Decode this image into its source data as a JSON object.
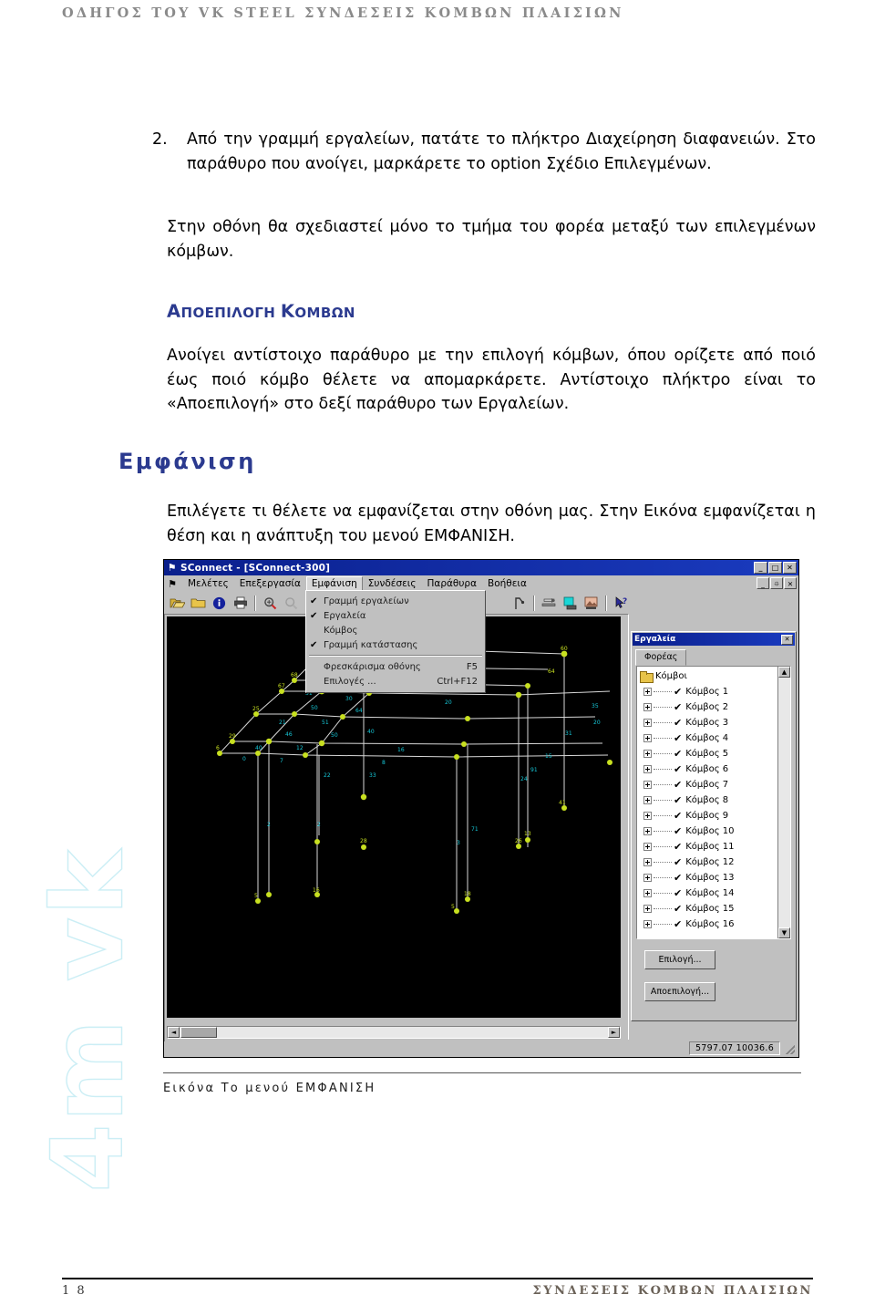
{
  "page": {
    "header": "ΟΔΗΓΟΣ ΤΟΥ VK STEEL ΣΥΝΔΕΣΕΙΣ ΚΟΜΒΩΝ ΠΛΑΙΣΙΩΝ",
    "watermark": "4m vk",
    "footer_page_number": "1 8",
    "footer_title": "ΣΥΝΔΕΣΕΙΣ ΚΟΜΒΩΝ ΠΛΑΙΣΙΩΝ"
  },
  "body": {
    "list_item_number": "2.",
    "list_item_text": "Από την γραμμή εργαλείων, πατάτε το πλήκτρο Διαχείρηση διαφανειών. Στο παράθυρο που ανοίγει, μαρκάρετε το option Σχέδιο Επιλεγμένων.",
    "paragraph_frame": "Στην οθόνη θα σχεδιαστεί μόνο το τμήμα του φορέα μεταξύ των επιλεγμένων κόμβων.",
    "heading_deselect_first": "Α",
    "heading_deselect_rest": "ΠΟΕΠΙΛΟΓΗ",
    "heading_deselect_second_first": "Κ",
    "heading_deselect_second_rest": "ΟΜΒΩΝ",
    "paragraph_deselect": "Ανοίγει αντίστοιχο παράθυρο με την επιλογή κόμβων, όπου ορίζετε από ποιό έως ποιό κόμβο θέλετε να απομαρκάρετε. Αντίστοιχο πλήκτρο είναι το «Αποεπιλογή» στο δεξί παράθυρο των Εργαλείων.",
    "heading_display": "Εμφάνιση",
    "paragraph_display": "Επιλέγετε τι θέλετε να εμφανίζεται στην οθόνη μας. Στην Εικόνα εμφανίζεται η θέση και η ανάπτυξη του μενού ΕΜΦΑΝΙΣΗ.",
    "figure_caption": "Εικόνα Το μενού ΕΜΦΑΝΙΣΗ"
  },
  "app": {
    "title": "SConnect  - [SConnect-300]",
    "title_icon": "flag-icon",
    "window_buttons": [
      "_",
      "□",
      "✕"
    ],
    "mdi_buttons": [
      "_",
      "⯐",
      "✕"
    ],
    "menu": [
      {
        "label": "Μελέτες",
        "active": false
      },
      {
        "label": "Επεξεργασία",
        "active": false
      },
      {
        "label": "Εμφάνιση",
        "active": true
      },
      {
        "label": "Συνδέσεις",
        "active": false
      },
      {
        "label": "Παράθυρα",
        "active": false
      },
      {
        "label": "Βοήθεια",
        "active": false
      }
    ],
    "toolbar_icons": [
      "open-folder-icon",
      "folder-icon",
      "info-icon",
      "print-icon",
      "zoom-in-icon",
      "zoom-out-icon",
      "pan-icon",
      "node-icon",
      "connection-icon",
      "panel-icon",
      "export-icon",
      "help-pointer-icon"
    ],
    "dropdown": {
      "items": [
        {
          "label": "Γραμμή εργαλείων",
          "checked": true,
          "accel": ""
        },
        {
          "label": "Εργαλεία",
          "checked": true,
          "accel": ""
        },
        {
          "label": "Κόμβος",
          "checked": false,
          "accel": ""
        },
        {
          "label": "Γραμμή κατάστασης",
          "checked": true,
          "accel": ""
        },
        {
          "separator": true
        },
        {
          "label": "Φρεσκάρισμα οθόνης",
          "checked": false,
          "accel": "F5"
        },
        {
          "label": "Επιλογές ...",
          "checked": false,
          "accel": "Ctrl+F12"
        }
      ]
    },
    "tools_panel": {
      "title": "Εργαλεία",
      "close_label": "✕",
      "tab": "Φορέας",
      "tree_root": "Κόμβοι",
      "tree_items": [
        "Κόμβος 1",
        "Κόμβος 2",
        "Κόμβος 3",
        "Κόμβος 4",
        "Κόμβος 5",
        "Κόμβος 6",
        "Κόμβος 7",
        "Κόμβος 8",
        "Κόμβος 9",
        "Κόμβος 10",
        "Κόμβος 11",
        "Κόμβος 12",
        "Κόμβος 13",
        "Κόμβος 14",
        "Κόμβος 15",
        "Κόμβος 16"
      ],
      "select_button": "Επιλογή...",
      "deselect_button": "Αποεπιλογή..."
    },
    "statusbar": {
      "coordinates": "5797.07  10036.6"
    },
    "scroll_arrows": {
      "left": "◄",
      "right": "►",
      "up": "▲",
      "down": "▼"
    }
  },
  "colors": {
    "heading_blue": "#2b3a8f",
    "header_gray": "#8a8a8a",
    "footer_brown": "#6b6258",
    "watermark_cyan": "#cbeef5",
    "titlebar_blue": "#0a1f8c",
    "window_face": "#c0c0c0",
    "canvas_black": "#000000",
    "node_green": "#c8e020",
    "member_cyan": "#16c8d8"
  }
}
